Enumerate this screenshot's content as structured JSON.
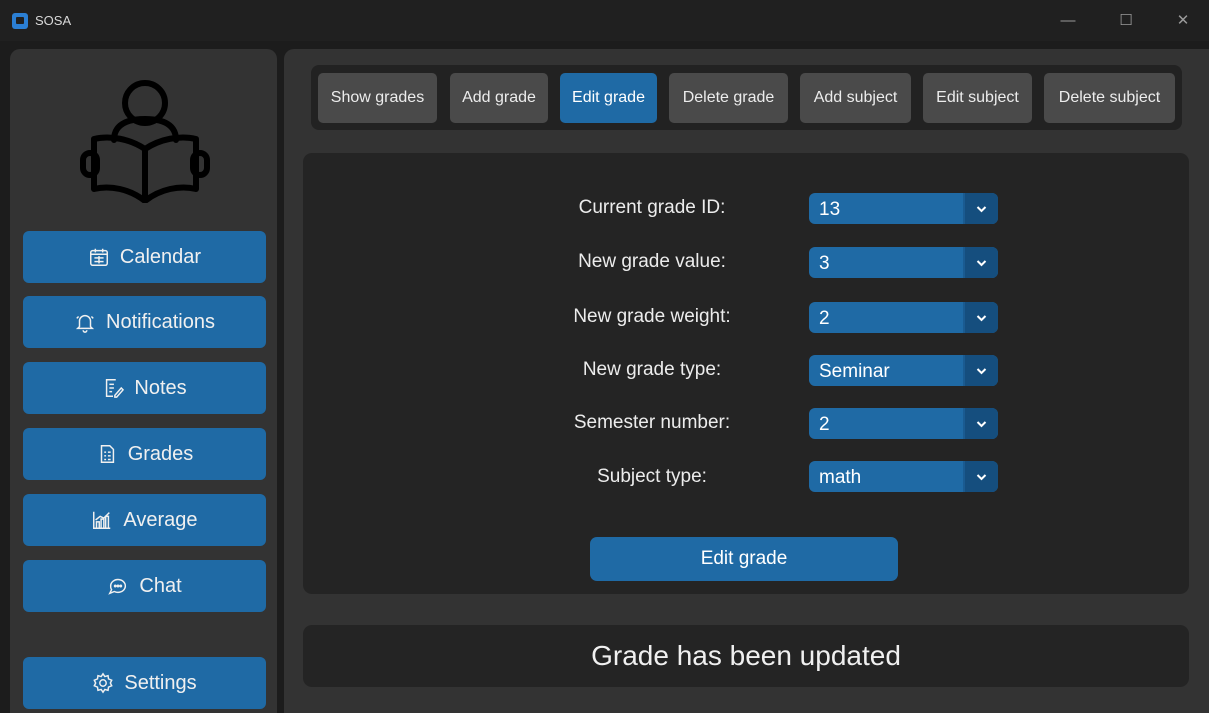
{
  "window": {
    "title": "SOSA",
    "controls": {
      "minimize": "—",
      "maximize": "☐",
      "close": "✕"
    }
  },
  "sidebar": {
    "logo_icon": "reading-person-icon",
    "items": [
      {
        "label": "Calendar",
        "icon": "calendar-icon"
      },
      {
        "label": "Notifications",
        "icon": "bell-icon"
      },
      {
        "label": "Notes",
        "icon": "notes-icon"
      },
      {
        "label": "Grades",
        "icon": "grades-icon"
      },
      {
        "label": "Average",
        "icon": "chart-icon"
      },
      {
        "label": "Chat",
        "icon": "chat-icon"
      }
    ],
    "settings": {
      "label": "Settings",
      "icon": "gear-icon"
    }
  },
  "tabs": [
    {
      "label": "Show grades",
      "active": false
    },
    {
      "label": "Add grade",
      "active": false
    },
    {
      "label": "Edit grade",
      "active": true
    },
    {
      "label": "Delete grade",
      "active": false
    },
    {
      "label": "Add subject",
      "active": false
    },
    {
      "label": "Edit subject",
      "active": false
    },
    {
      "label": "Delete subject",
      "active": false
    }
  ],
  "form": {
    "fields": [
      {
        "label": "Current grade ID:",
        "value": "13"
      },
      {
        "label": "New grade value:",
        "value": "3"
      },
      {
        "label": "New grade weight:",
        "value": "2"
      },
      {
        "label": "New grade type:",
        "value": "Seminar"
      },
      {
        "label": "Semester number:",
        "value": "2"
      },
      {
        "label": "Subject type:",
        "value": "math"
      }
    ],
    "submit_label": "Edit grade"
  },
  "status": {
    "message": "Grade has been updated"
  },
  "colors": {
    "accent": "#1f6aa5",
    "accent_dark": "#154e7e",
    "panel": "#333333",
    "panel_dark": "#242424",
    "tab_inactive": "#4a4a4a",
    "titlebar": "#202020"
  }
}
